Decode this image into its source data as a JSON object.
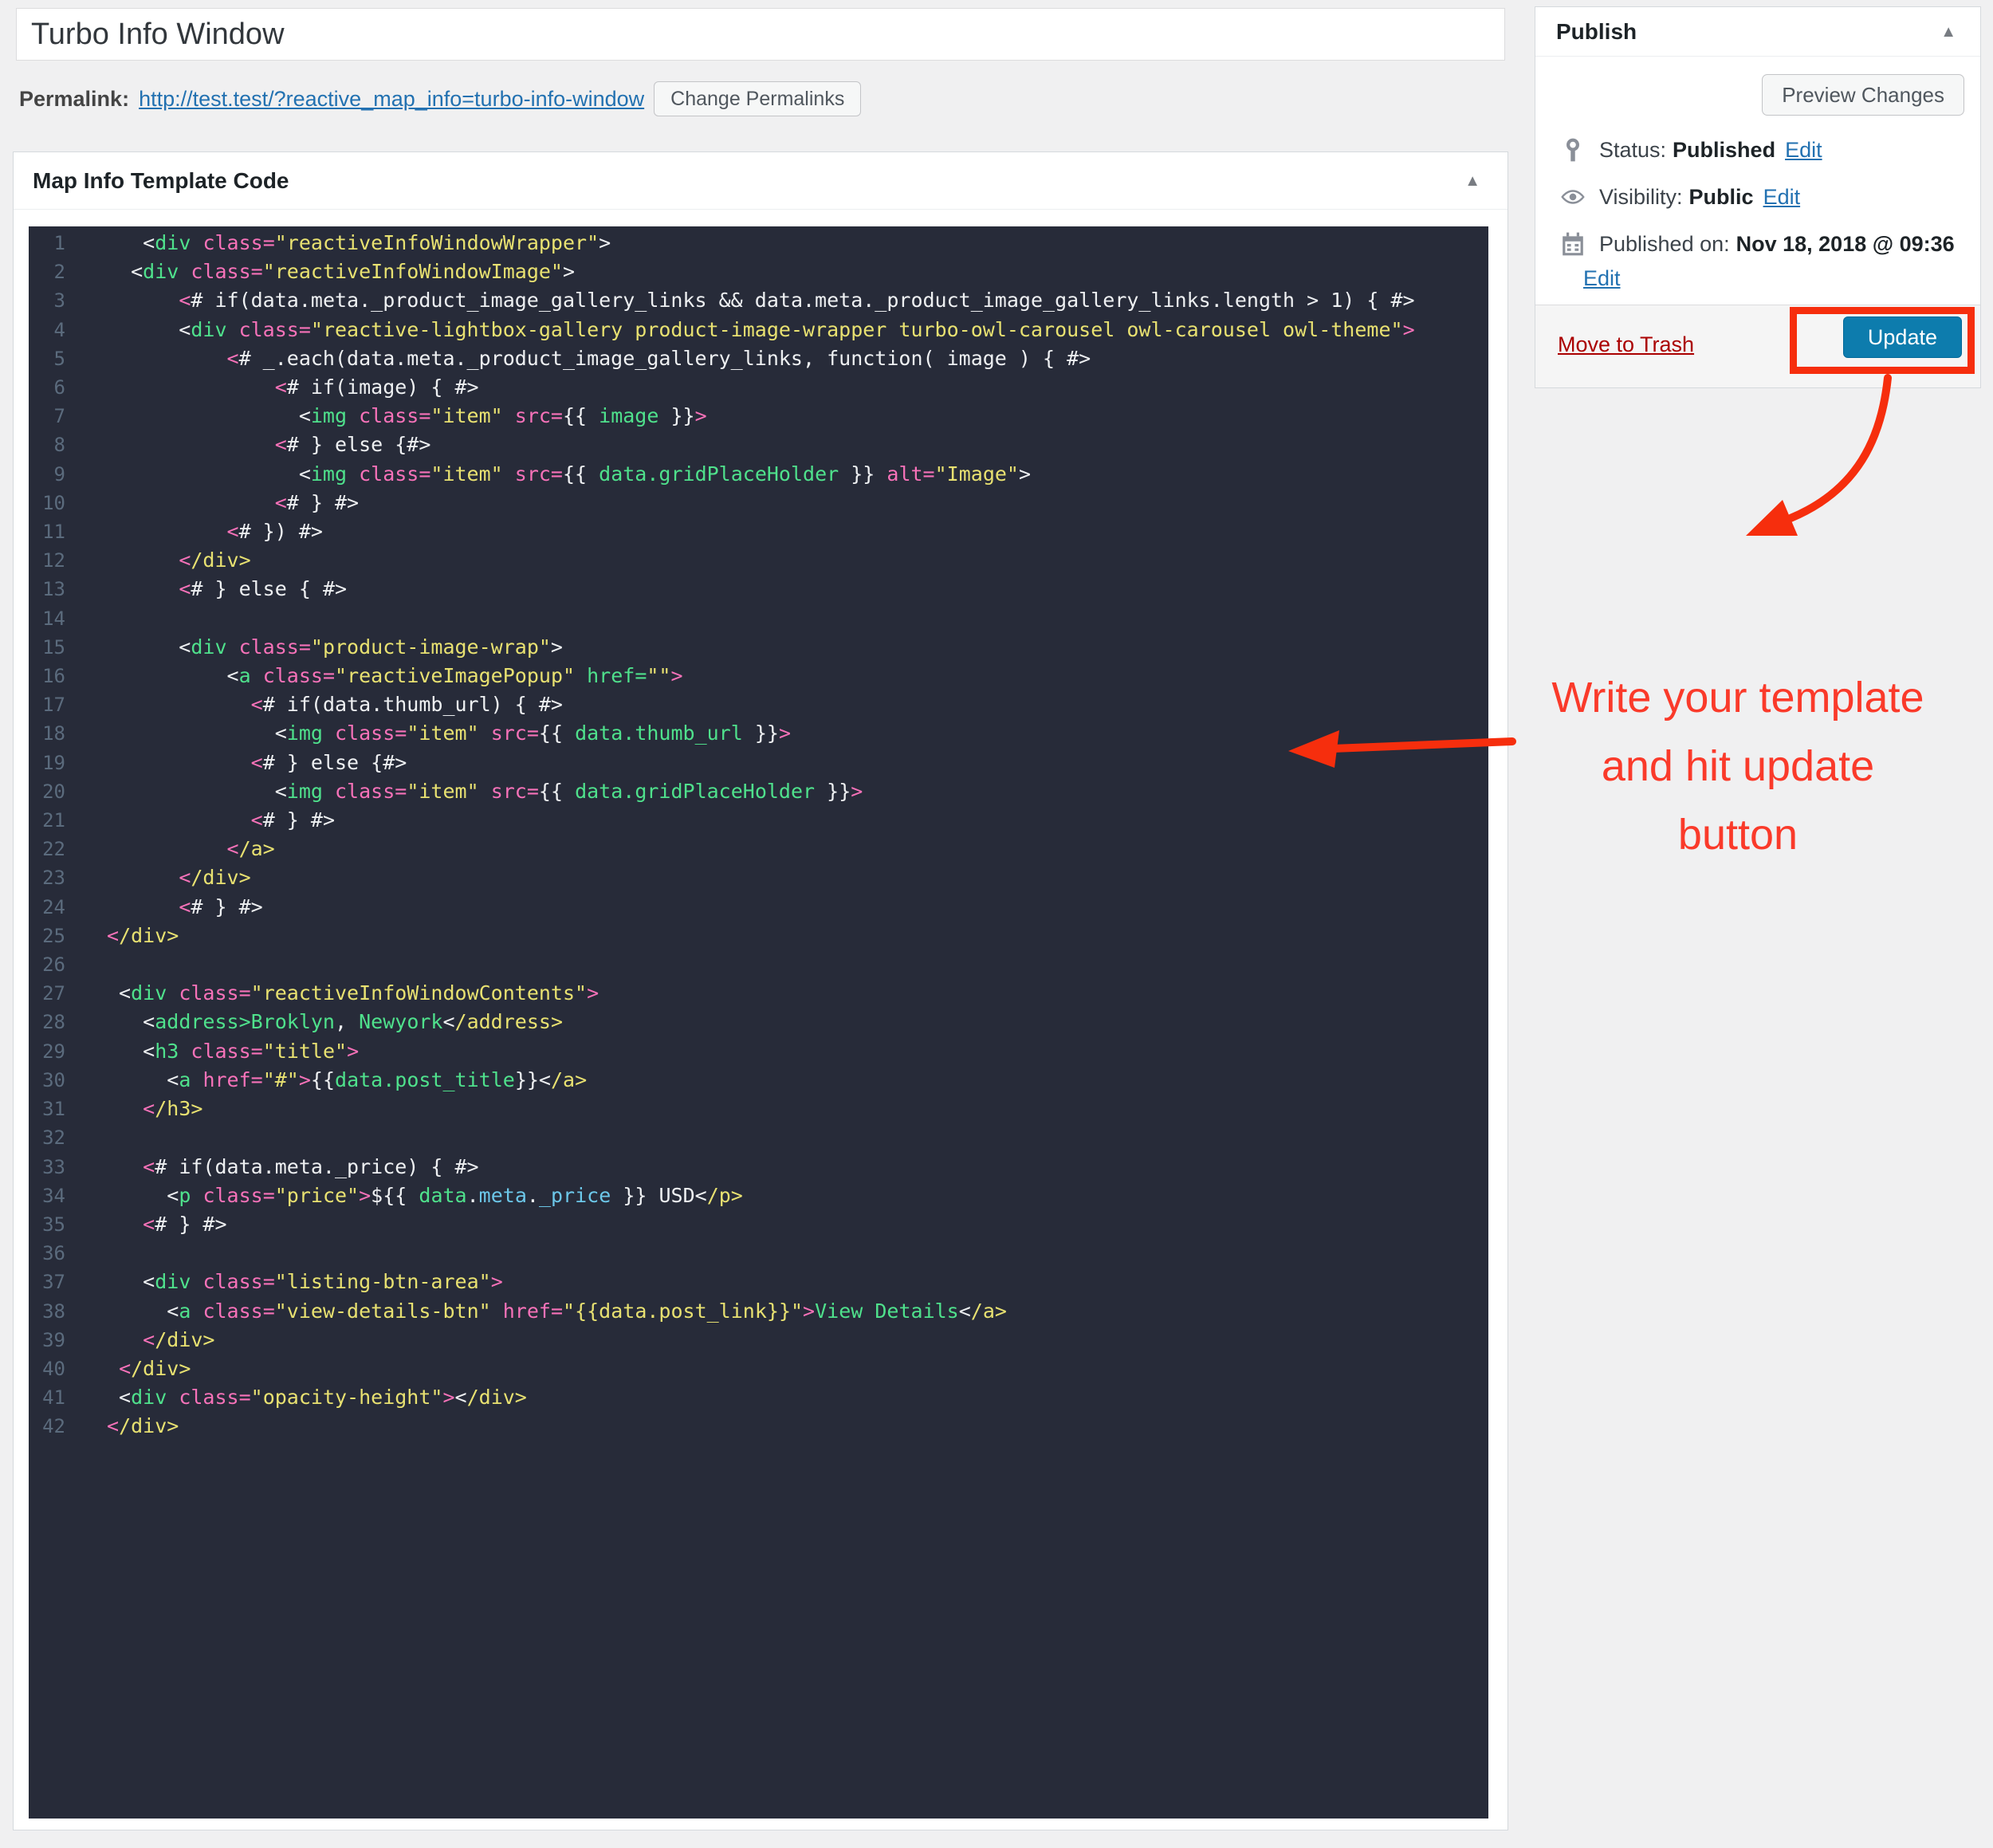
{
  "title_input": {
    "value": "Turbo Info Window"
  },
  "permalink": {
    "label": "Permalink:",
    "url": "http://test.test/?reactive_map_info=turbo-info-window",
    "button_label": "Change Permalinks"
  },
  "editor_box": {
    "title": "Map Info Template Code",
    "collapse_icon": "▲"
  },
  "code": {
    "colors": {
      "background": "#272b39",
      "plain": "#eef0f2",
      "tag": "#4fe18c",
      "attribute": "#f772b9",
      "string": "#e8e171",
      "property": "#6cc7e9",
      "line_number": "#5b6b7d"
    },
    "lines": [
      {
        "n": 1,
        "segs": [
          [
            "w",
            "   <"
          ],
          [
            "g",
            "div"
          ],
          [
            "w",
            " "
          ],
          [
            "p",
            "class="
          ],
          [
            "y",
            "\"reactiveInfoWindowWrapper\""
          ],
          [
            "w",
            ">"
          ]
        ]
      },
      {
        "n": 2,
        "segs": [
          [
            "w",
            "  <"
          ],
          [
            "g",
            "div"
          ],
          [
            "w",
            " "
          ],
          [
            "p",
            "class="
          ],
          [
            "y",
            "\"reactiveInfoWindowImage\""
          ],
          [
            "w",
            ">"
          ]
        ]
      },
      {
        "n": 3,
        "segs": [
          [
            "w",
            "      "
          ],
          [
            "p",
            "<"
          ],
          [
            "w",
            "# if(data.meta._product_image_gallery_links && data.meta._product_image_gallery_links.length > 1) { #>"
          ]
        ]
      },
      {
        "n": 4,
        "segs": [
          [
            "w",
            "      <"
          ],
          [
            "g",
            "div"
          ],
          [
            "w",
            " "
          ],
          [
            "p",
            "class="
          ],
          [
            "y",
            "\"reactive-lightbox-gallery product-image-wrapper turbo-owl-carousel owl-carousel owl-theme\""
          ],
          [
            "p",
            ">"
          ]
        ]
      },
      {
        "n": 5,
        "segs": [
          [
            "w",
            "          "
          ],
          [
            "p",
            "<"
          ],
          [
            "w",
            "# _.each(data.meta._product_image_gallery_links, function( image ) { #>"
          ]
        ]
      },
      {
        "n": 6,
        "segs": [
          [
            "w",
            "              "
          ],
          [
            "p",
            "<"
          ],
          [
            "w",
            "# if(image) { #>"
          ]
        ]
      },
      {
        "n": 7,
        "segs": [
          [
            "w",
            "                <"
          ],
          [
            "g",
            "img"
          ],
          [
            "w",
            " "
          ],
          [
            "p",
            "class="
          ],
          [
            "y",
            "\"item\""
          ],
          [
            "w",
            " "
          ],
          [
            "p",
            "src="
          ],
          [
            "w",
            "{{ "
          ],
          [
            "g",
            "image"
          ],
          [
            "w",
            " }}"
          ],
          [
            "p",
            ">"
          ]
        ]
      },
      {
        "n": 8,
        "segs": [
          [
            "w",
            "              "
          ],
          [
            "p",
            "<"
          ],
          [
            "w",
            "# } else {#>"
          ]
        ]
      },
      {
        "n": 9,
        "segs": [
          [
            "w",
            "                <"
          ],
          [
            "g",
            "img"
          ],
          [
            "w",
            " "
          ],
          [
            "p",
            "class="
          ],
          [
            "y",
            "\"item\""
          ],
          [
            "w",
            " "
          ],
          [
            "p",
            "src="
          ],
          [
            "w",
            "{{ "
          ],
          [
            "g",
            "data.gridPlaceHolder"
          ],
          [
            "w",
            " }} "
          ],
          [
            "p",
            "alt="
          ],
          [
            "y",
            "\"Image\""
          ],
          [
            "w",
            ">"
          ]
        ]
      },
      {
        "n": 10,
        "segs": [
          [
            "w",
            "              "
          ],
          [
            "p",
            "<"
          ],
          [
            "w",
            "# } #>"
          ]
        ]
      },
      {
        "n": 11,
        "segs": [
          [
            "w",
            "          "
          ],
          [
            "p",
            "<"
          ],
          [
            "w",
            "# }) #>"
          ]
        ]
      },
      {
        "n": 12,
        "segs": [
          [
            "w",
            "      "
          ],
          [
            "p",
            "<"
          ],
          [
            "y",
            "/div>"
          ]
        ]
      },
      {
        "n": 13,
        "segs": [
          [
            "w",
            "      "
          ],
          [
            "p",
            "<"
          ],
          [
            "w",
            "# } else { #>"
          ]
        ]
      },
      {
        "n": 14,
        "segs": []
      },
      {
        "n": 15,
        "segs": [
          [
            "w",
            "      <"
          ],
          [
            "g",
            "div"
          ],
          [
            "w",
            " "
          ],
          [
            "p",
            "class="
          ],
          [
            "y",
            "\"product-image-wrap\""
          ],
          [
            "w",
            ">"
          ]
        ]
      },
      {
        "n": 16,
        "segs": [
          [
            "w",
            "          <"
          ],
          [
            "g",
            "a"
          ],
          [
            "w",
            " "
          ],
          [
            "p",
            "class="
          ],
          [
            "y",
            "\"reactiveImagePopup\""
          ],
          [
            "w",
            " "
          ],
          [
            "g",
            "href="
          ],
          [
            "y",
            "\"\""
          ],
          [
            "p",
            ">"
          ]
        ]
      },
      {
        "n": 17,
        "segs": [
          [
            "w",
            "            "
          ],
          [
            "p",
            "<"
          ],
          [
            "w",
            "# if(data.thumb_url) { #>"
          ]
        ]
      },
      {
        "n": 18,
        "segs": [
          [
            "w",
            "              <"
          ],
          [
            "g",
            "img"
          ],
          [
            "w",
            " "
          ],
          [
            "p",
            "class="
          ],
          [
            "y",
            "\"item\""
          ],
          [
            "w",
            " "
          ],
          [
            "p",
            "src="
          ],
          [
            "w",
            "{{ "
          ],
          [
            "g",
            "data.thumb_url"
          ],
          [
            "w",
            " }}"
          ],
          [
            "p",
            ">"
          ]
        ]
      },
      {
        "n": 19,
        "segs": [
          [
            "w",
            "            "
          ],
          [
            "p",
            "<"
          ],
          [
            "w",
            "# } else {#>"
          ]
        ]
      },
      {
        "n": 20,
        "segs": [
          [
            "w",
            "              <"
          ],
          [
            "g",
            "img"
          ],
          [
            "w",
            " "
          ],
          [
            "p",
            "class="
          ],
          [
            "y",
            "\"item\""
          ],
          [
            "w",
            " "
          ],
          [
            "p",
            "src="
          ],
          [
            "w",
            "{{ "
          ],
          [
            "g",
            "data.gridPlaceHolder"
          ],
          [
            "w",
            " }}"
          ],
          [
            "p",
            ">"
          ]
        ]
      },
      {
        "n": 21,
        "segs": [
          [
            "w",
            "            "
          ],
          [
            "p",
            "<"
          ],
          [
            "w",
            "# } #>"
          ]
        ]
      },
      {
        "n": 22,
        "segs": [
          [
            "w",
            "          "
          ],
          [
            "p",
            "<"
          ],
          [
            "y",
            "/a>"
          ]
        ]
      },
      {
        "n": 23,
        "segs": [
          [
            "w",
            "      "
          ],
          [
            "p",
            "<"
          ],
          [
            "y",
            "/div>"
          ]
        ]
      },
      {
        "n": 24,
        "segs": [
          [
            "w",
            "      "
          ],
          [
            "p",
            "<"
          ],
          [
            "w",
            "# } #>"
          ]
        ]
      },
      {
        "n": 25,
        "segs": [
          [
            "p",
            "<"
          ],
          [
            "y",
            "/div>"
          ]
        ]
      },
      {
        "n": 26,
        "segs": []
      },
      {
        "n": 27,
        "segs": [
          [
            "w",
            " <"
          ],
          [
            "g",
            "div"
          ],
          [
            "w",
            " "
          ],
          [
            "p",
            "class="
          ],
          [
            "y",
            "\"reactiveInfoWindowContents\""
          ],
          [
            "p",
            ">"
          ]
        ]
      },
      {
        "n": 28,
        "segs": [
          [
            "w",
            "   <"
          ],
          [
            "g",
            "address>Broklyn"
          ],
          [
            "w",
            ", "
          ],
          [
            "g",
            "Newyork"
          ],
          [
            "w",
            "<"
          ],
          [
            "y",
            "/address>"
          ]
        ]
      },
      {
        "n": 29,
        "segs": [
          [
            "w",
            "   <"
          ],
          [
            "g",
            "h3"
          ],
          [
            "w",
            " "
          ],
          [
            "p",
            "class="
          ],
          [
            "y",
            "\"title\""
          ],
          [
            "p",
            ">"
          ]
        ]
      },
      {
        "n": 30,
        "segs": [
          [
            "w",
            "     <"
          ],
          [
            "g",
            "a"
          ],
          [
            "w",
            " "
          ],
          [
            "p",
            "href="
          ],
          [
            "y",
            "\"#\""
          ],
          [
            "p",
            ">"
          ],
          [
            "w",
            "{{"
          ],
          [
            "g",
            "data.post_title"
          ],
          [
            "w",
            "}}<"
          ],
          [
            "y",
            "/a>"
          ]
        ]
      },
      {
        "n": 31,
        "segs": [
          [
            "w",
            "   "
          ],
          [
            "p",
            "<"
          ],
          [
            "y",
            "/h3>"
          ]
        ]
      },
      {
        "n": 32,
        "segs": []
      },
      {
        "n": 33,
        "segs": [
          [
            "w",
            "   "
          ],
          [
            "p",
            "<"
          ],
          [
            "w",
            "# if(data.meta._price) { #>"
          ]
        ]
      },
      {
        "n": 34,
        "segs": [
          [
            "w",
            "     <"
          ],
          [
            "g",
            "p"
          ],
          [
            "w",
            " "
          ],
          [
            "p",
            "class="
          ],
          [
            "y",
            "\"price\""
          ],
          [
            "p",
            ">"
          ],
          [
            "w",
            "${{ "
          ],
          [
            "g",
            "data"
          ],
          [
            "w",
            "."
          ],
          [
            "c",
            "meta"
          ],
          [
            "w",
            "."
          ],
          [
            "c",
            "_price"
          ],
          [
            "w",
            " }} USD<"
          ],
          [
            "y",
            "/p>"
          ]
        ]
      },
      {
        "n": 35,
        "segs": [
          [
            "w",
            "   "
          ],
          [
            "p",
            "<"
          ],
          [
            "w",
            "# } #>"
          ]
        ]
      },
      {
        "n": 36,
        "segs": []
      },
      {
        "n": 37,
        "segs": [
          [
            "w",
            "   <"
          ],
          [
            "g",
            "div"
          ],
          [
            "w",
            " "
          ],
          [
            "p",
            "class="
          ],
          [
            "y",
            "\"listing-btn-area\""
          ],
          [
            "p",
            ">"
          ]
        ]
      },
      {
        "n": 38,
        "segs": [
          [
            "w",
            "     <"
          ],
          [
            "g",
            "a"
          ],
          [
            "w",
            " "
          ],
          [
            "p",
            "class="
          ],
          [
            "y",
            "\"view-details-btn\""
          ],
          [
            "w",
            " "
          ],
          [
            "p",
            "href="
          ],
          [
            "y",
            "\"{{data.post_link}}\""
          ],
          [
            "p",
            ">"
          ],
          [
            "g",
            "View Details"
          ],
          [
            "w",
            "<"
          ],
          [
            "y",
            "/a>"
          ]
        ]
      },
      {
        "n": 39,
        "segs": [
          [
            "w",
            "   "
          ],
          [
            "p",
            "<"
          ],
          [
            "y",
            "/div>"
          ]
        ]
      },
      {
        "n": 40,
        "segs": [
          [
            "w",
            " "
          ],
          [
            "p",
            "<"
          ],
          [
            "y",
            "/div>"
          ]
        ]
      },
      {
        "n": 41,
        "segs": [
          [
            "w",
            " <"
          ],
          [
            "g",
            "div"
          ],
          [
            "w",
            " "
          ],
          [
            "p",
            "class="
          ],
          [
            "y",
            "\"opacity-height\""
          ],
          [
            "p",
            ">"
          ],
          [
            "w",
            "<"
          ],
          [
            "y",
            "/div>"
          ]
        ]
      },
      {
        "n": 42,
        "segs": [
          [
            "p",
            "<"
          ],
          [
            "y",
            "/div>"
          ]
        ]
      }
    ]
  },
  "publish": {
    "title": "Publish",
    "collapse_icon": "▲",
    "preview_button": "Preview Changes",
    "rows": [
      {
        "icon": "pin-icon",
        "label": "Status:",
        "value": "Published",
        "edit": "Edit",
        "edit_wrapped": false
      },
      {
        "icon": "eye-icon",
        "label": "Visibility:",
        "value": "Public",
        "edit": "Edit",
        "edit_wrapped": false
      },
      {
        "icon": "calendar-icon",
        "label": "Published on:",
        "value": "Nov 18, 2018 @ 09:36",
        "edit": "Edit",
        "edit_wrapped": true
      }
    ],
    "trash_label": "Move to Trash",
    "update_label": "Update",
    "update_color": "#0d7cad",
    "link_color": "#2271b1",
    "trash_color": "#aa0000"
  },
  "annotation": {
    "lines": [
      "Write your template",
      "and hit update",
      "button"
    ],
    "color": "#fa3a2a",
    "shape_color": "#f62e0d"
  }
}
